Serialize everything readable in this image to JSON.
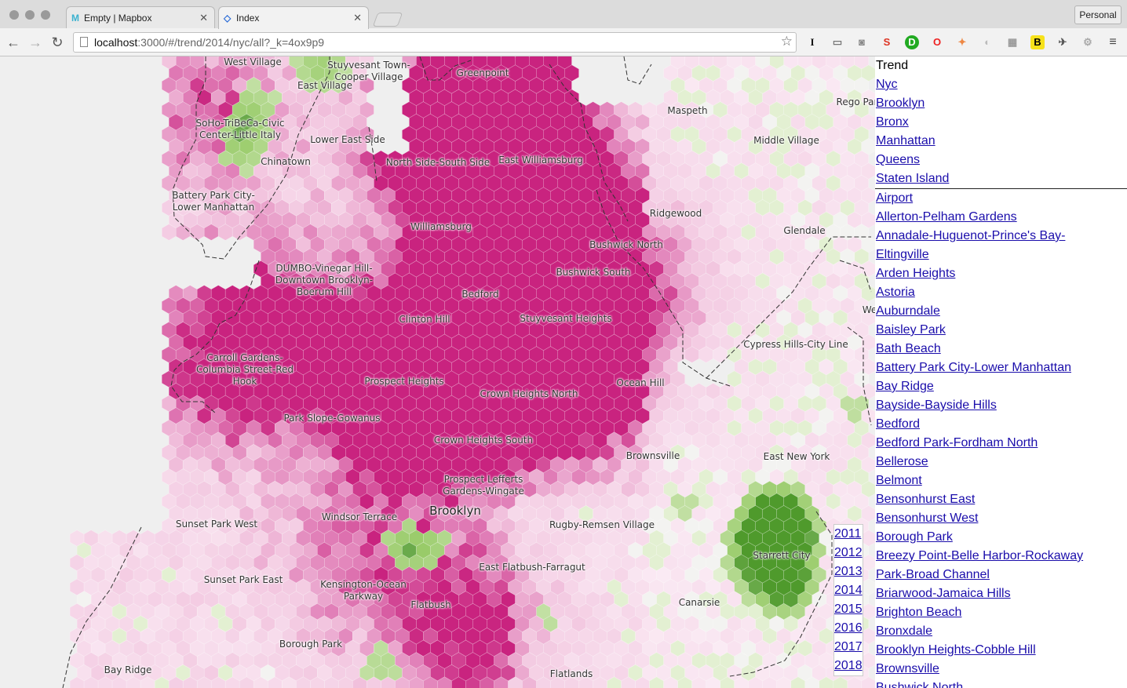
{
  "browser": {
    "tabs": [
      {
        "label": "Empty | Mapbox",
        "favicon": "M"
      },
      {
        "label": "Index",
        "favicon": "◇"
      }
    ],
    "profile": "Personal",
    "url": {
      "host": "localhost",
      "path": ":3000/#/trend/2014/nyc/all?_k=4ox9p9"
    },
    "extensions": [
      "I",
      "cast-icon",
      "camera-icon",
      "S",
      "D",
      "O",
      "bird-icon",
      "refresh-icon",
      "puzzle-icon",
      "B",
      "pin-icon",
      "gear-icon"
    ]
  },
  "map": {
    "labels": [
      {
        "text": "West Village"
      },
      {
        "text": "Stuyvesant Town-\nCooper Village"
      },
      {
        "text": "Greenpoint"
      },
      {
        "text": "East Village"
      },
      {
        "text": "SoHo-TriBeCa-Civic\nCenter-Little Italy"
      },
      {
        "text": "Lower East Side"
      },
      {
        "text": "Chinatown"
      },
      {
        "text": "North Side-South Side"
      },
      {
        "text": "East Williamsburg"
      },
      {
        "text": "Maspeth"
      },
      {
        "text": "Rego Par"
      },
      {
        "text": "Middle Village"
      },
      {
        "text": "Battery Park City-\nLower Manhattan"
      },
      {
        "text": "Ridgewood"
      },
      {
        "text": "Glendale"
      },
      {
        "text": "Williamsburg"
      },
      {
        "text": "Bushwick North"
      },
      {
        "text": "DUMBO-Vinegar Hill-\nDowntown Brooklyn-\nBoerum Hill"
      },
      {
        "text": "Bushwick South"
      },
      {
        "text": "Bedford"
      },
      {
        "text": "Clinton Hill"
      },
      {
        "text": "Stuyvesant Heights"
      },
      {
        "text": "Cypress Hills-City Line"
      },
      {
        "text": "Carroll Gardens-\nColumbia Street-Red\nHook"
      },
      {
        "text": "Prospect Heights"
      },
      {
        "text": "Crown Heights North"
      },
      {
        "text": "Ocean Hill"
      },
      {
        "text": "Park Slope-Gowanus"
      },
      {
        "text": "Crown Heights South"
      },
      {
        "text": "Brownsville"
      },
      {
        "text": "East New York"
      },
      {
        "text": "Prospect Lefferts\nGardens-Wingate"
      },
      {
        "text": "Brooklyn"
      },
      {
        "text": "Sunset Park West"
      },
      {
        "text": "Windsor Terrace"
      },
      {
        "text": "Rugby-Remsen Village"
      },
      {
        "text": "Starrett City"
      },
      {
        "text": "Sunset Park East"
      },
      {
        "text": "East Flatbush-Farragut"
      },
      {
        "text": "Kensington-Ocean\nParkway"
      },
      {
        "text": "Canarsie"
      },
      {
        "text": "Flatbush"
      },
      {
        "text": "Borough Park"
      },
      {
        "text": "Bay Ridge"
      },
      {
        "text": "Flatlands"
      },
      {
        "text": "We"
      }
    ]
  },
  "years": [
    "2011",
    "2012",
    "2013",
    "2014",
    "2015",
    "2016",
    "2017",
    "2018"
  ],
  "sidebar": {
    "title": "Trend",
    "boroughs": [
      "Nyc",
      "Brooklyn",
      "Bronx",
      "Manhattan",
      "Queens",
      "Staten Island"
    ],
    "neighborhoods": [
      "Airport",
      "Allerton-Pelham Gardens",
      "Annadale-Huguenot-Prince's Bay-",
      "Eltingville",
      "Arden Heights",
      "Astoria",
      "Auburndale",
      "Baisley Park",
      "Bath Beach",
      "Battery Park City-Lower Manhattan",
      "Bay Ridge",
      "Bayside-Bayside Hills",
      "Bedford",
      "Bedford Park-Fordham North",
      "Bellerose",
      "Belmont",
      "Bensonhurst East",
      "Bensonhurst West",
      "Borough Park",
      "Breezy Point-Belle Harbor-Rockaway",
      "Park-Broad Channel",
      "Briarwood-Jamaica Hills",
      "Brighton Beach",
      "Bronxdale",
      "Brooklyn Heights-Cobble Hill",
      "Brownsville",
      "Bushwick North"
    ]
  },
  "colors": {
    "link": "#1a0dab",
    "hotPink": "#c9237f",
    "midPink": "#e07cb6",
    "lightPink": "#f3c9e1",
    "paleGreen": "#e3f0d2",
    "green": "#86c24f",
    "darkGreen": "#4f9a2c"
  }
}
